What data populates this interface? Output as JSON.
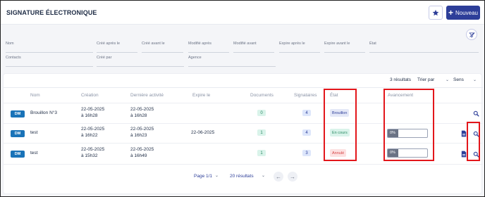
{
  "header": {
    "title": "SIGNATURE ÉLECTRONIQUE",
    "new_button_label": "Nouveau"
  },
  "filters": {
    "row1": [
      "Nom",
      "Créé après le",
      "Créé avant le",
      "Modifié après",
      "Modifié avant",
      "Expire après le",
      "Expire avant le",
      "État"
    ],
    "row2": [
      "Contacts",
      "Créé par",
      "Agence"
    ]
  },
  "toolbar": {
    "results": "3 résultats",
    "sort_label": "Trier par",
    "direction_label": "Sens"
  },
  "columns": {
    "nom": "Nom",
    "creation": "Création",
    "last_activity": "Dernière activité",
    "expire": "Expire le",
    "documents": "Documents",
    "signataires": "Signataires",
    "etat": "État",
    "avancement": "Avancement"
  },
  "rows": [
    {
      "type": "DM",
      "name": "Brouillon N°3",
      "created_date": "22-05-2025",
      "created_time": "à 16h28",
      "activity_date": "22-05-2025",
      "activity_time": "à 16h28",
      "expire": "",
      "documents": "0",
      "signataires": "4",
      "state": "Brouillon",
      "progress_label": "",
      "progress": null
    },
    {
      "type": "DM",
      "name": "test",
      "created_date": "22-05-2025",
      "created_time": "à 16h22",
      "activity_date": "22-05-2025",
      "activity_time": "à 16h23",
      "expire": "22-06-2025",
      "documents": "1",
      "signataires": "4",
      "state": "En cours",
      "progress_label": "0%",
      "progress": 0
    },
    {
      "type": "DM",
      "name": "test",
      "created_date": "22-05-2025",
      "created_time": "à 15h32",
      "activity_date": "22-05-2025",
      "activity_time": "à 16h49",
      "expire": "",
      "documents": "1",
      "signataires": "3",
      "state": "Annulé",
      "progress_label": "0%",
      "progress": 0
    }
  ],
  "pagination": {
    "page_label": "Page 1/1",
    "per_page_label": "20 résultats"
  },
  "colors": {
    "primary": "#2d3e99",
    "dm_badge": "#1a73b8",
    "highlight": "#e3161b"
  },
  "icons": [
    "star-icon",
    "plus-icon",
    "filter-icon",
    "chevron-down-icon",
    "search-icon",
    "document-icon",
    "arrow-left-icon",
    "arrow-right-icon"
  ]
}
